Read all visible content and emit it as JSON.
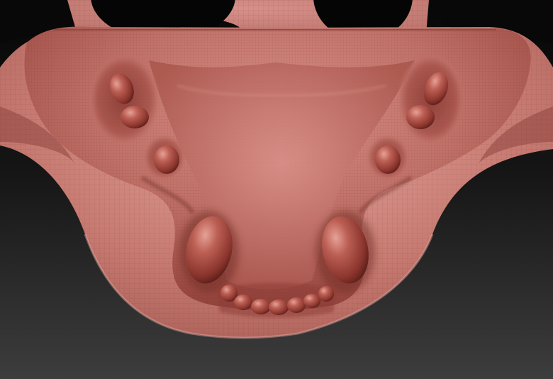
{
  "viewport": {
    "background_top": "#0b0b0b",
    "background_bottom": "#3c3c3c"
  },
  "mesh": {
    "base_color": "#b86a62",
    "light_color": "#e2a49b",
    "mid_color": "#c9766d",
    "dark_color": "#6f2f2a",
    "shadow_color": "#4a1a16",
    "wire_color": "#7b3a35"
  }
}
